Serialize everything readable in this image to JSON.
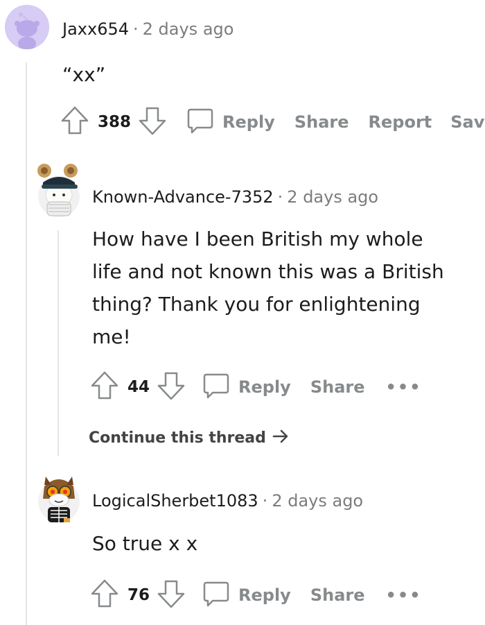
{
  "comments": [
    {
      "username": "Jaxx654",
      "time": "2 days ago",
      "body": "“xx”",
      "score": "388",
      "actions": {
        "reply": "Reply",
        "share": "Share",
        "report": "Report",
        "save": "Save"
      },
      "avatar_icon": "default-snoo-avatar-icon"
    },
    {
      "username": "Known-Advance-7352",
      "time": "2 days ago",
      "body": "How have I been British my whole life and not known this was a British thing? Thank you for enlightening me!",
      "score": "44",
      "actions": {
        "reply": "Reply",
        "share": "Share",
        "more": "•••"
      },
      "avatar_icon": "snoo-mouse-ears-cap-avatar-icon"
    },
    {
      "username": "LogicalSherbet1083",
      "time": "2 days ago",
      "body": "So true x x",
      "score": "76",
      "actions": {
        "reply": "Reply",
        "share": "Share",
        "more": "•••"
      },
      "avatar_icon": "snoo-owl-avatar-icon"
    }
  ],
  "continue_thread": "Continue this thread",
  "separator": "·",
  "colors": {
    "meta_gray": "#7c7c7c",
    "action_gray": "#878a8c",
    "thread_line": "#e3e5e8",
    "avatar_bg": "#d8d0f3"
  }
}
